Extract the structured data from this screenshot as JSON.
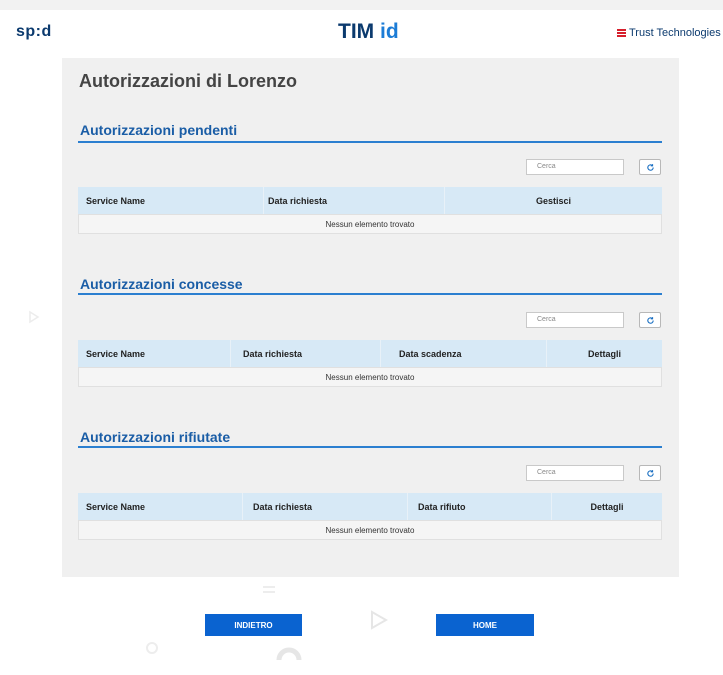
{
  "header": {
    "spid": "sp:d",
    "tim": "TIM",
    "id": "id",
    "trust": "Trust Technologies"
  },
  "page": {
    "title": "Autorizzazioni di Lorenzo"
  },
  "sections": [
    {
      "title": "Autorizzazioni pendenti",
      "search_placeholder": "Cerca",
      "columns": [
        "Service Name",
        "Data richiesta",
        "Gestisci"
      ],
      "empty": "Nessun elemento trovato"
    },
    {
      "title": "Autorizzazioni concesse",
      "search_placeholder": "Cerca",
      "columns": [
        "Service Name",
        "Data richiesta",
        "Data scadenza",
        "Dettagli"
      ],
      "empty": "Nessun elemento trovato"
    },
    {
      "title": "Autorizzazioni rifiutate",
      "search_placeholder": "Cerca",
      "columns": [
        "Service Name",
        "Data richiesta",
        "Data rifiuto",
        "Dettagli"
      ],
      "empty": "Nessun elemento trovato"
    }
  ],
  "buttons": {
    "back": "INDIETRO",
    "home": "HOME"
  },
  "colors": {
    "brand_blue": "#0a63d0",
    "header_navy": "#0b3a6e",
    "table_header": "#d7e9f6",
    "section_rule": "#2b7fd0"
  }
}
